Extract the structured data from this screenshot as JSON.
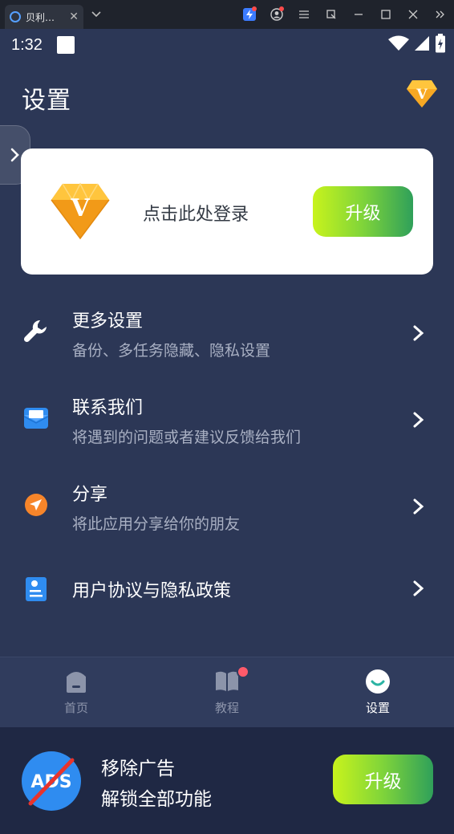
{
  "window": {
    "tab_title": "贝利…",
    "tab_close": "✕",
    "tab_dropdown": "⌄",
    "tools": [
      "lightning-icon",
      "account-icon",
      "menu-icon",
      "restore-icon",
      "minimize-icon",
      "maximize-icon",
      "close-icon",
      "more-icon"
    ]
  },
  "status_bar": {
    "time": "1:32"
  },
  "header": {
    "title": "设置"
  },
  "login_card": {
    "prompt": "点击此处登录",
    "upgrade_label": "升级"
  },
  "menu": [
    {
      "title": "更多设置",
      "subtitle": "备份、多任务隐藏、隐私设置",
      "icon": "wrench-icon"
    },
    {
      "title": "联系我们",
      "subtitle": "将遇到的问题或者建议反馈给我们",
      "icon": "mail-icon"
    },
    {
      "title": "分享",
      "subtitle": "将此应用分享给你的朋友",
      "icon": "share-icon"
    },
    {
      "title": "用户协议与隐私政策",
      "subtitle": "",
      "icon": "document-icon"
    }
  ],
  "bottom_nav": [
    {
      "label": "首页",
      "icon": "home-icon",
      "active": false
    },
    {
      "label": "教程",
      "icon": "book-icon",
      "active": false,
      "has_dot": true
    },
    {
      "label": "设置",
      "icon": "settings-smile-icon",
      "active": true
    }
  ],
  "ads_banner": {
    "line1": "移除广告",
    "line2": "解锁全部功能",
    "icon_text": "ADS",
    "upgrade_label": "升级"
  },
  "colors": {
    "background": "#2c3756",
    "card": "#ffffff",
    "accent_gold": "#f5a623",
    "button_gradient_start": "#c8f31c",
    "button_gradient_end": "#2fa05a",
    "subtitle": "#a9b0c3"
  }
}
